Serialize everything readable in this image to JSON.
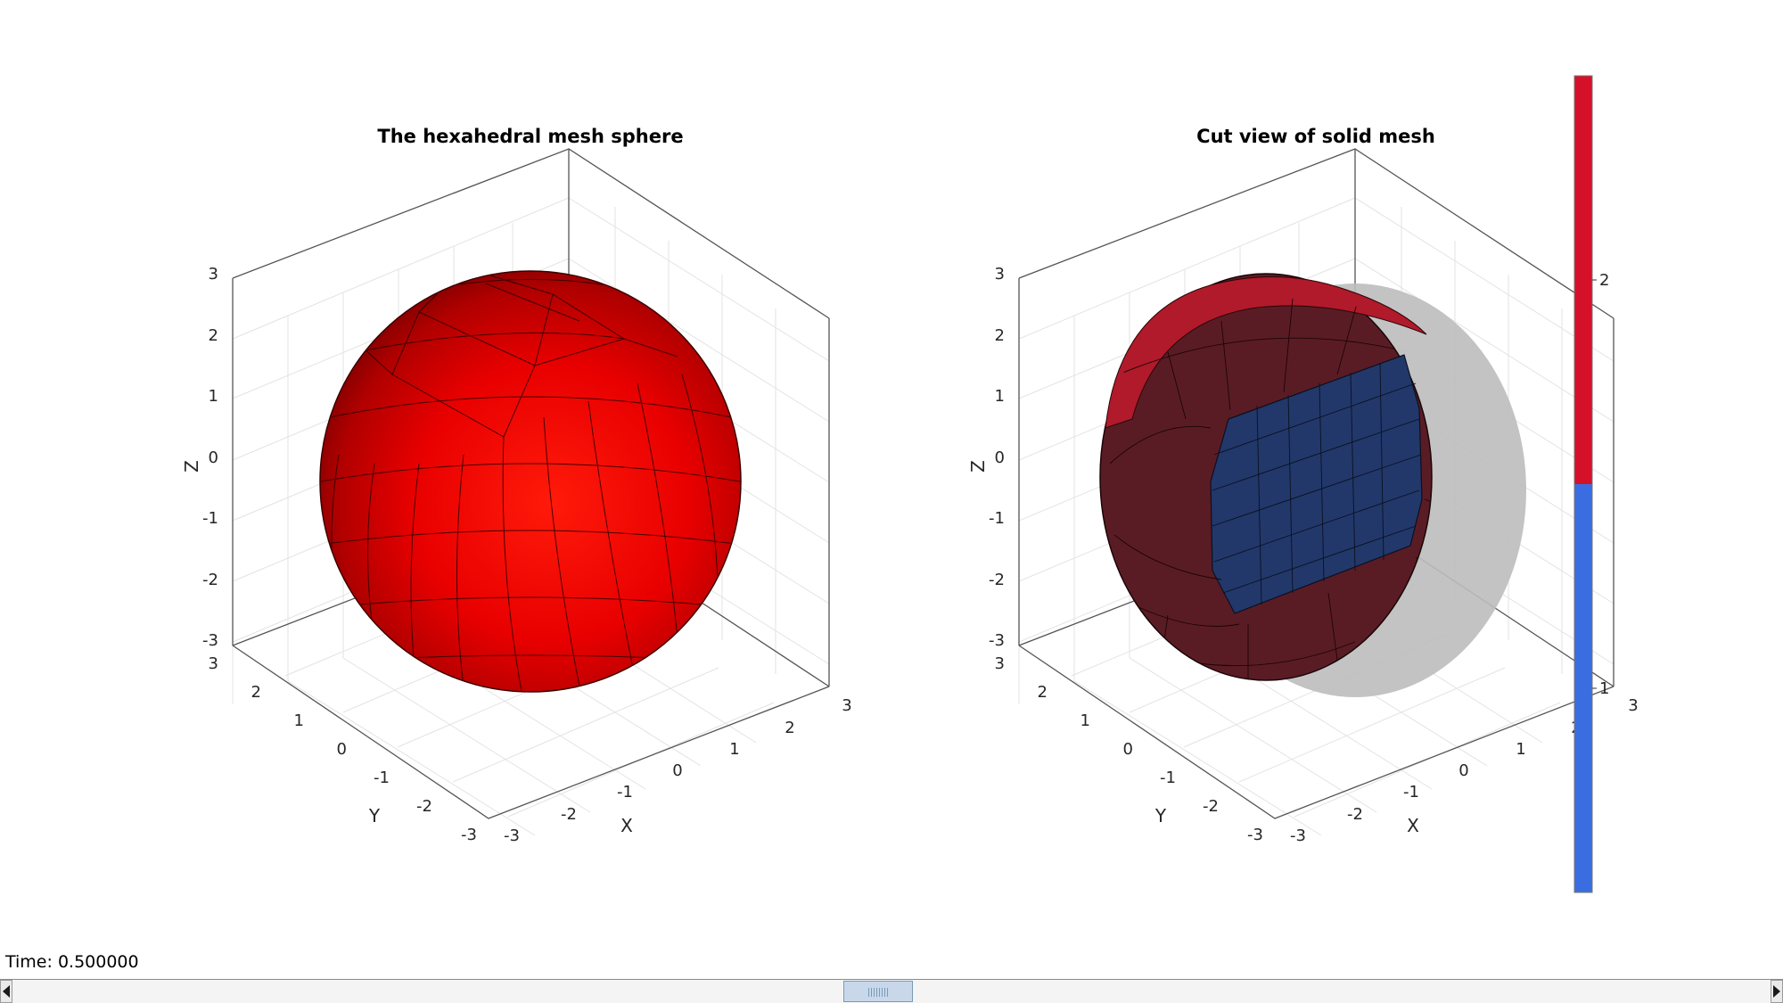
{
  "window": {
    "status_text": "Time: 0.500000"
  },
  "plots": [
    {
      "title": "The hexahedral mesh sphere",
      "xlabel": "X",
      "ylabel": "Y",
      "zlabel": "Z",
      "ticks": [
        "-3",
        "-2",
        "-1",
        "0",
        "1",
        "2",
        "3"
      ],
      "surface_color": "#e60000",
      "edge_color": "#1a0000"
    },
    {
      "title": "Cut view of solid mesh",
      "xlabel": "X",
      "ylabel": "Y",
      "zlabel": "Z",
      "ticks": [
        "-3",
        "-2",
        "-1",
        "0",
        "1",
        "2",
        "3"
      ],
      "outer_color": "#b01a2a",
      "cut_face_color": "#5a1c24",
      "inner_color": "#22386a",
      "ghost_color": "#bdbdbd"
    }
  ],
  "colorbar": {
    "segments": [
      {
        "value": 2,
        "color": "#d7102a"
      },
      {
        "value": 1,
        "color": "#3a6ee0"
      }
    ],
    "tick_labels": [
      "2",
      "1"
    ]
  }
}
